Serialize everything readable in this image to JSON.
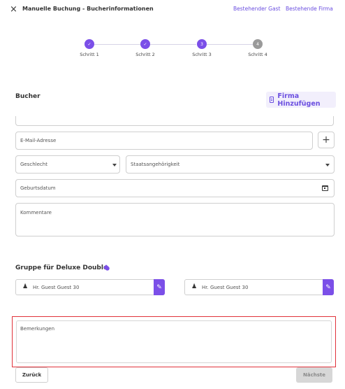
{
  "header": {
    "close_icon": "×",
    "title": "Manuelle Buchung - Bucherinformationen",
    "existing_guest_link": "Bestehender Gast",
    "existing_company_link": "Bestehende Firma"
  },
  "stepper": {
    "steps": [
      {
        "label": "Schritt 1",
        "marker": "✓",
        "state": "done"
      },
      {
        "label": "Schritt 2",
        "marker": "✓",
        "state": "done"
      },
      {
        "label": "Schritt 3",
        "marker": "3",
        "state": "active"
      },
      {
        "label": "Schritt 4",
        "marker": "4",
        "state": "inactive"
      }
    ]
  },
  "booker": {
    "title": "Bucher",
    "add_company_button": "Firma Hinzufügen",
    "email_placeholder": "E-Mail-Adresse",
    "plus_label": "+",
    "gender_placeholder": "Geschlecht",
    "nationality_placeholder": "Staatsangehörigkeit",
    "birthdate_placeholder": "Geburtsdatum",
    "comments_placeholder": "Kommentare"
  },
  "group": {
    "title": "Gruppe für Deluxe Double",
    "guests": [
      {
        "name": "Hr.  Guest  Guest  30"
      },
      {
        "name": "Hr.  Guest  Guest  30"
      }
    ],
    "edit_icon": "✎"
  },
  "remarks_placeholder": "Bemerkungen",
  "footer": {
    "back_button": "Zurück",
    "next_button": "Nächste"
  },
  "colors": {
    "accent": "#7b4fe8",
    "link": "#6b4fe0",
    "highlight_border": "#e0323a"
  }
}
